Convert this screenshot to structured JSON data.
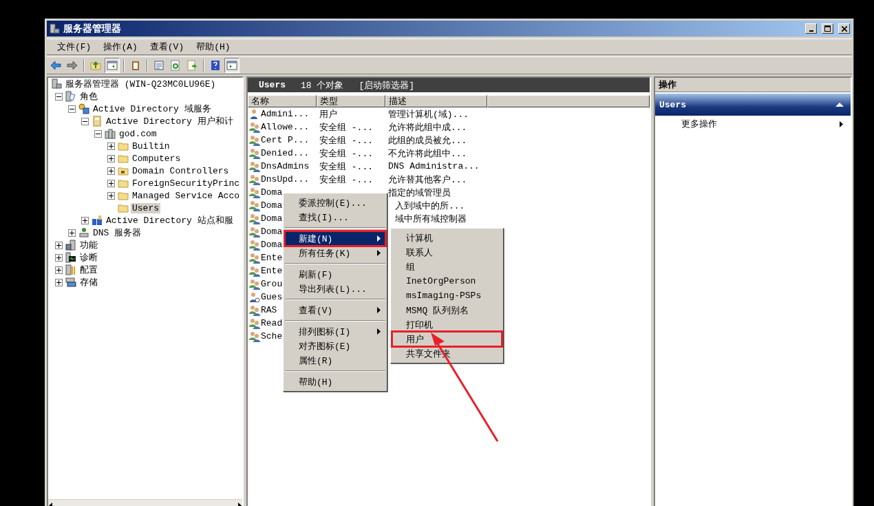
{
  "window": {
    "title": "服务器管理器"
  },
  "menu": [
    "文件(F)",
    "操作(A)",
    "查看(V)",
    "帮助(H)"
  ],
  "toolbar": [
    {
      "kind": "back",
      "pressed": false
    },
    {
      "kind": "forward",
      "pressed": false
    },
    {
      "kind": "separator"
    },
    {
      "kind": "up",
      "pressed": false
    },
    {
      "kind": "tree",
      "pressed": true
    },
    {
      "kind": "separator"
    },
    {
      "kind": "clipboard",
      "pressed": false
    },
    {
      "kind": "separator"
    },
    {
      "kind": "properties",
      "pressed": false
    },
    {
      "kind": "refresh",
      "pressed": false
    },
    {
      "kind": "export",
      "pressed": false
    },
    {
      "kind": "separator"
    },
    {
      "kind": "help",
      "pressed": false
    },
    {
      "kind": "pane",
      "pressed": true
    }
  ],
  "tree": {
    "label": "服务器管理器 (WIN-Q23MC0LU96E)",
    "kind": "server",
    "selected": false,
    "children": [
      {
        "label": "角色",
        "kind": "roles",
        "expanded": true,
        "selected": false,
        "children": [
          {
            "label": "Active Directory 域服务",
            "kind": "adds",
            "expanded": true,
            "selected": false,
            "children": [
              {
                "label": "Active Directory 用户和计",
                "kind": "book",
                "expanded": true,
                "selected": false,
                "children": [
                  {
                    "label": "god.com",
                    "kind": "domain",
                    "expanded": true,
                    "selected": false,
                    "children": [
                      {
                        "label": "Builtin",
                        "kind": "folder",
                        "expanded": false,
                        "selected": false
                      },
                      {
                        "label": "Computers",
                        "kind": "folder",
                        "expanded": false,
                        "selected": false
                      },
                      {
                        "label": "Domain Controllers",
                        "kind": "ou",
                        "expanded": false,
                        "selected": false
                      },
                      {
                        "label": "ForeignSecurityPrinc",
                        "kind": "folder",
                        "expanded": false,
                        "selected": false
                      },
                      {
                        "label": "Managed Service Acco",
                        "kind": "folder",
                        "expanded": false,
                        "selected": false
                      },
                      {
                        "label": "Users",
                        "kind": "folder",
                        "selected": true
                      }
                    ]
                  }
                ]
              },
              {
                "label": "Active Directory 站点和服",
                "kind": "sites",
                "expanded": false,
                "selected": false
              }
            ]
          },
          {
            "label": "DNS 服务器",
            "kind": "dns",
            "expanded": false,
            "selected": false
          }
        ]
      },
      {
        "label": "功能",
        "kind": "features",
        "expanded": false,
        "selected": false
      },
      {
        "label": "诊断",
        "kind": "diagnostics",
        "expanded": false,
        "selected": false
      },
      {
        "label": "配置",
        "kind": "config",
        "expanded": false,
        "selected": false
      },
      {
        "label": "存储",
        "kind": "storage",
        "expanded": false,
        "selected": false
      }
    ]
  },
  "list": {
    "title": "Users",
    "count": "18 个对象",
    "filter": "[启动筛选器]",
    "columns": [
      "名称",
      "类型",
      "描述"
    ],
    "rows": [
      {
        "kind": "user",
        "name": "Admini...",
        "type": "用户",
        "description": "管理计算机(域)..."
      },
      {
        "kind": "group",
        "name": "Allowe...",
        "type": "安全组 -...",
        "description": "允许将此组中成..."
      },
      {
        "kind": "group",
        "name": "Cert P...",
        "type": "安全组 -...",
        "description": "此组的成员被允..."
      },
      {
        "kind": "group",
        "name": "Denied...",
        "type": "安全组 -...",
        "description": "不允许将此组中..."
      },
      {
        "kind": "group",
        "name": "DnsAdmins",
        "type": "安全组 -...",
        "description": "DNS Administra..."
      },
      {
        "kind": "group",
        "name": "DnsUpd...",
        "type": "安全组 -...",
        "description": "允许替其他客户..."
      },
      {
        "kind": "group",
        "name": "Doma",
        "description": "指定的域管理员"
      },
      {
        "kind": "group",
        "name": "Doma",
        "description": "入到域中的所...",
        "partly_hidden": true
      },
      {
        "kind": "group",
        "name": "Doma",
        "description": "域中所有域控制器",
        "partly_hidden": true
      },
      {
        "kind": "group",
        "name": "Doma"
      },
      {
        "kind": "group",
        "name": "Doma"
      },
      {
        "kind": "group",
        "name": "Ente"
      },
      {
        "kind": "group",
        "name": "Ente"
      },
      {
        "kind": "group",
        "name": "Grou"
      },
      {
        "kind": "guest",
        "name": "Gues"
      },
      {
        "kind": "group",
        "name": "RAS"
      },
      {
        "kind": "group",
        "name": "Read"
      },
      {
        "kind": "group",
        "name": "Sche"
      }
    ]
  },
  "actions": {
    "header": "操作",
    "section": {
      "title": "Users",
      "expanded": true
    },
    "items": [
      {
        "label": "更多操作",
        "kind": "submenu"
      }
    ]
  },
  "context_menu": [
    {
      "kind": "item",
      "label": "委派控制(E)...",
      "selected": false
    },
    {
      "kind": "item",
      "label": "查找(I)...",
      "selected": false
    },
    {
      "kind": "separator"
    },
    {
      "kind": "submenu",
      "label": "新建(N)",
      "selected": true,
      "annotated": true
    },
    {
      "kind": "submenu",
      "label": "所有任务(K)",
      "selected": false
    },
    {
      "kind": "separator"
    },
    {
      "kind": "item",
      "label": "刷新(F)",
      "selected": false
    },
    {
      "kind": "item",
      "label": "导出列表(L)...",
      "selected": false
    },
    {
      "kind": "separator"
    },
    {
      "kind": "submenu",
      "label": "查看(V)",
      "selected": false
    },
    {
      "kind": "separator"
    },
    {
      "kind": "submenu",
      "label": "排列图标(I)",
      "selected": false
    },
    {
      "kind": "item",
      "label": "对齐图标(E)",
      "selected": false
    },
    {
      "kind": "item",
      "label": "属性(R)",
      "selected": false
    },
    {
      "kind": "separator"
    },
    {
      "kind": "item",
      "label": "帮助(H)",
      "selected": false
    }
  ],
  "submenu": [
    {
      "kind": "item",
      "label": "计算机",
      "selected": false
    },
    {
      "kind": "item",
      "label": "联系人",
      "selected": false
    },
    {
      "kind": "item",
      "label": "组",
      "selected": false
    },
    {
      "kind": "item",
      "label": "InetOrgPerson",
      "selected": false
    },
    {
      "kind": "item",
      "label": "msImaging-PSPs",
      "selected": false
    },
    {
      "kind": "item",
      "label": "MSMQ 队列别名",
      "selected": false
    },
    {
      "kind": "item",
      "label": "打印机",
      "selected": false
    },
    {
      "kind": "item",
      "label": "用户",
      "selected": false,
      "annotated": true
    },
    {
      "kind": "item",
      "label": "共享文件夹",
      "selected": false
    }
  ],
  "annotation_arrow": {
    "kind": "arrow"
  }
}
